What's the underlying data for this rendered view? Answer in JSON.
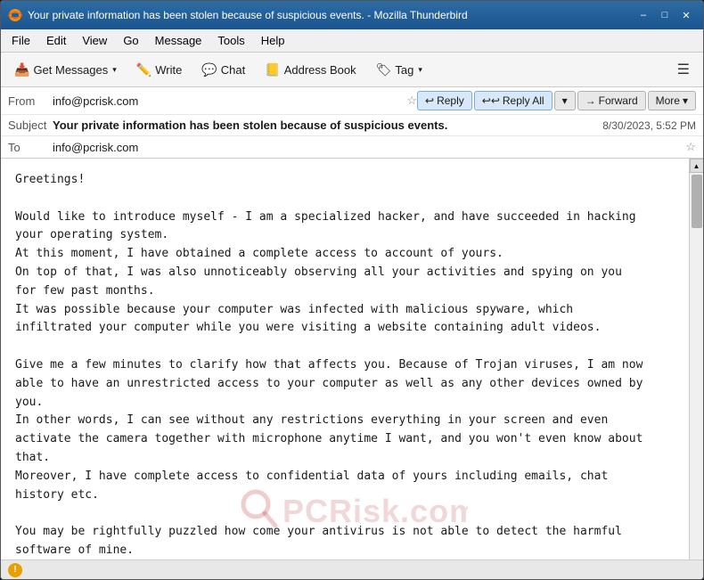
{
  "window": {
    "title": "Your private information has been stolen because of suspicious events. - Mozilla Thunderbird",
    "icon": "thunderbird"
  },
  "title_bar": {
    "minimize_label": "–",
    "maximize_label": "□",
    "close_label": "✕"
  },
  "menu_bar": {
    "items": [
      "File",
      "Edit",
      "View",
      "Go",
      "Message",
      "Tools",
      "Help"
    ]
  },
  "toolbar": {
    "get_messages_label": "Get Messages",
    "write_label": "Write",
    "chat_label": "Chat",
    "address_book_label": "Address Book",
    "tag_label": "Tag"
  },
  "email_actions": {
    "reply_label": "Reply",
    "reply_all_label": "Reply All",
    "forward_label": "Forward",
    "more_label": "More"
  },
  "email_header": {
    "from_label": "From",
    "from_value": "info@pcrisk.com",
    "subject_label": "Subject",
    "subject_value": "Your private information has been stolen because of suspicious events.",
    "to_label": "To",
    "to_value": "info@pcrisk.com",
    "date": "8/30/2023, 5:52 PM"
  },
  "email_body": "Greetings!\n\nWould like to introduce myself - I am a specialized hacker, and have succeeded in hacking\nyour operating system.\nAt this moment, I have obtained a complete access to account of yours.\nOn top of that, I was also unnoticeably observing all your activities and spying on you\nfor few past months.\nIt was possible because your computer was infected with malicious spyware, which\ninfiltrated your computer while you were visiting a website containing adult videos.\n\nGive me a few minutes to clarify how that affects you. Because of Trojan viruses, I am now\nable to have an unrestricted access to your computer as well as any other devices owned by\nyou.\nIn other words, I can see without any restrictions everything in your screen and even\nactivate the camera together with microphone anytime I want, and you won't even know about\nthat.\nMoreover, I have complete access to confidential data of yours including emails, chat\nhistory etc.\n\nYou may be rightfully puzzled how come your antivirus is not able to detect the harmful\nsoftware of mine.\nI don't mind explaining that at all: my malicious software is driver-based; hence it\nrenames its signatures every 4 hours,\nwhich makes it impossible for your antivirus to identify it.",
  "watermark": {
    "text": "PCRisk.com",
    "search_icon_color": "#e83030"
  },
  "status_bar": {
    "icon": "!",
    "text": ""
  }
}
